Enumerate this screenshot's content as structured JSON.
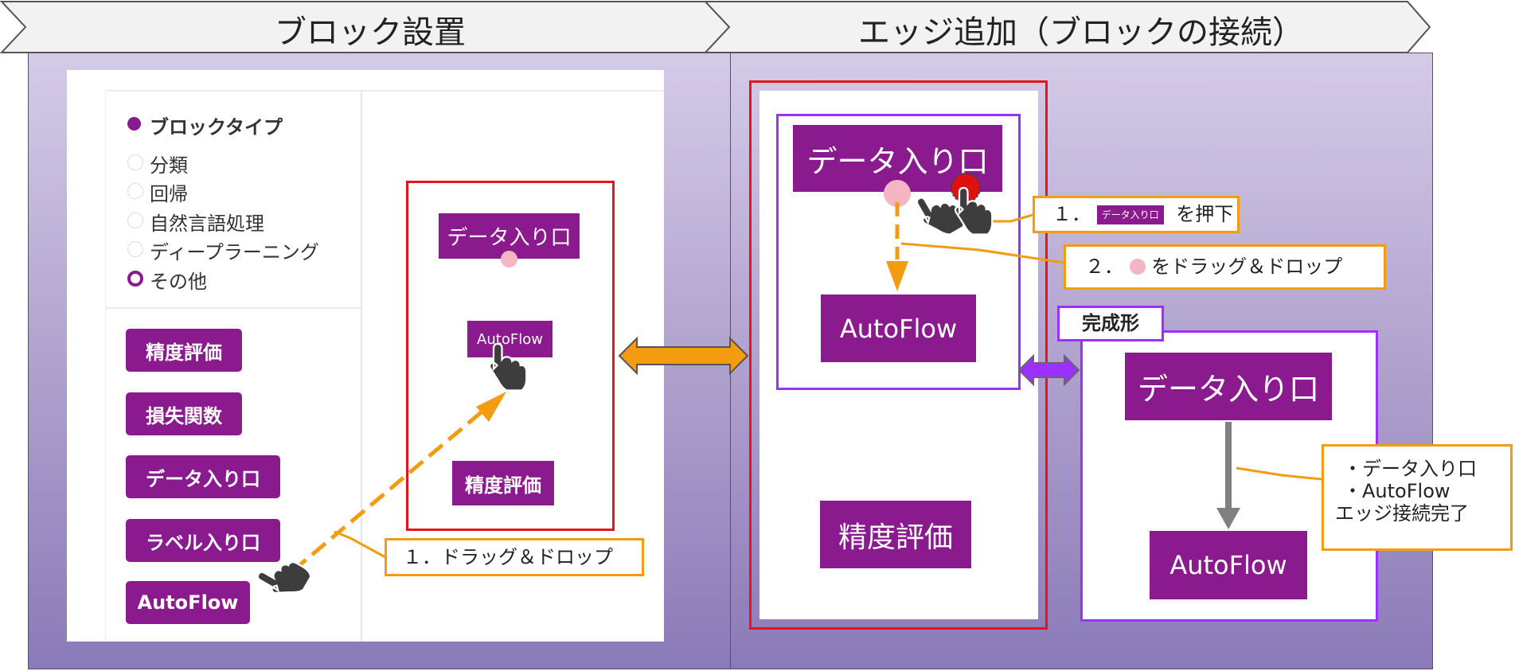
{
  "headers": {
    "left": "ブロック設置",
    "right": "エッジ追加（ブロックの接続）"
  },
  "sidebar": {
    "section_title": "ブロックタイプ",
    "options": [
      "分類",
      "回帰",
      "自然言語処理",
      "ディープラーニング",
      "その他"
    ],
    "selected": "その他",
    "palette": [
      "精度評価",
      "損失関数",
      "データ入り口",
      "ラベル入り口",
      "AutoFlow"
    ]
  },
  "left_canvas": {
    "blocks": [
      "データ入り口",
      "AutoFlow",
      "精度評価"
    ]
  },
  "left_callout": "１．ドラッグ＆ドロップ",
  "mid_canvas": {
    "blocks": [
      "データ入り口",
      "AutoFlow",
      "精度評価"
    ]
  },
  "callout_press": {
    "prefix": "１．",
    "mini_block": "データ入り口",
    "suffix": "を押下"
  },
  "callout_drag": {
    "prefix": "２．",
    "suffix": "をドラッグ＆ドロップ"
  },
  "completed": {
    "label": "完成形",
    "blocks": [
      "データ入り口",
      "AutoFlow"
    ],
    "note_lines": [
      "・データ入り口",
      "・AutoFlow",
      "エッジ接続完了"
    ]
  },
  "colors": {
    "block": "#8b1a8f",
    "arrow_orange": "#f39c12",
    "arrow_purple": "#9b30ff",
    "frame_red": "#e8141c",
    "frame_purple": "#9b30ff",
    "port": "#f4b6c2",
    "port_active": "#e01010"
  }
}
